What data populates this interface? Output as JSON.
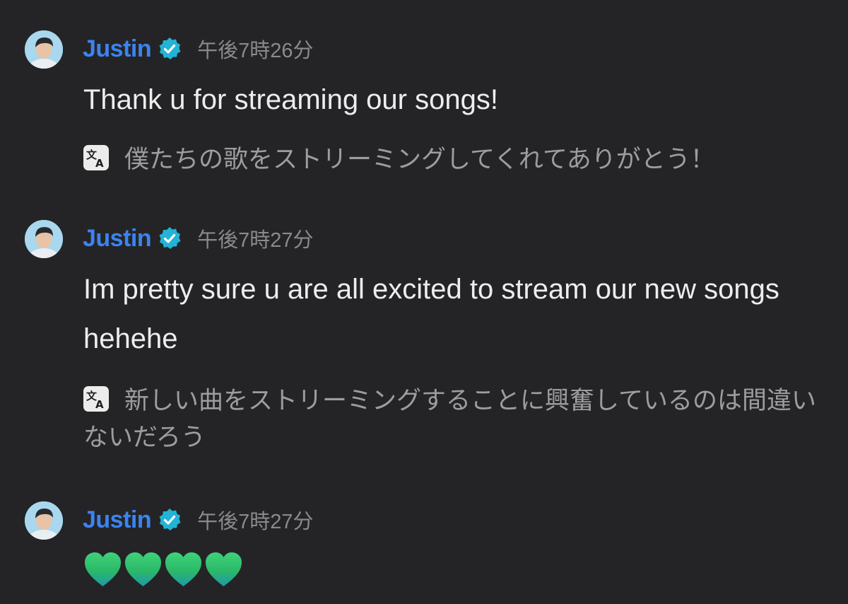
{
  "messages": [
    {
      "username": "Justin",
      "avatar_icon": "user-avatar",
      "verified_icon": "verified-badge-icon",
      "timestamp": "午後7時26分",
      "text": "Thank u for streaming our songs!",
      "translate_icon": "translate-icon",
      "translation": "僕たちの歌をストリーミングしてくれてありがとう！"
    },
    {
      "username": "Justin",
      "avatar_icon": "user-avatar",
      "verified_icon": "verified-badge-icon",
      "timestamp": "午後7時27分",
      "text": "Im pretty sure u are all excited to stream our new songs hehehe",
      "translate_icon": "translate-icon",
      "translation": "新しい曲をストリーミングすることに興奮しているのは間違いないだろう"
    },
    {
      "username": "Justin",
      "avatar_icon": "user-avatar",
      "verified_icon": "verified-badge-icon",
      "timestamp": "午後7時27分",
      "emoji": [
        "green-heart",
        "green-heart",
        "green-heart",
        "green-heart"
      ]
    }
  ],
  "colors": {
    "background": "#242426",
    "username": "#3b84f0",
    "verified_badge": "#22b3d6",
    "timestamp": "#8a8a8a",
    "message_text": "#ededed",
    "translation_text": "#9d9d9d",
    "heart": "#2ec36b"
  }
}
